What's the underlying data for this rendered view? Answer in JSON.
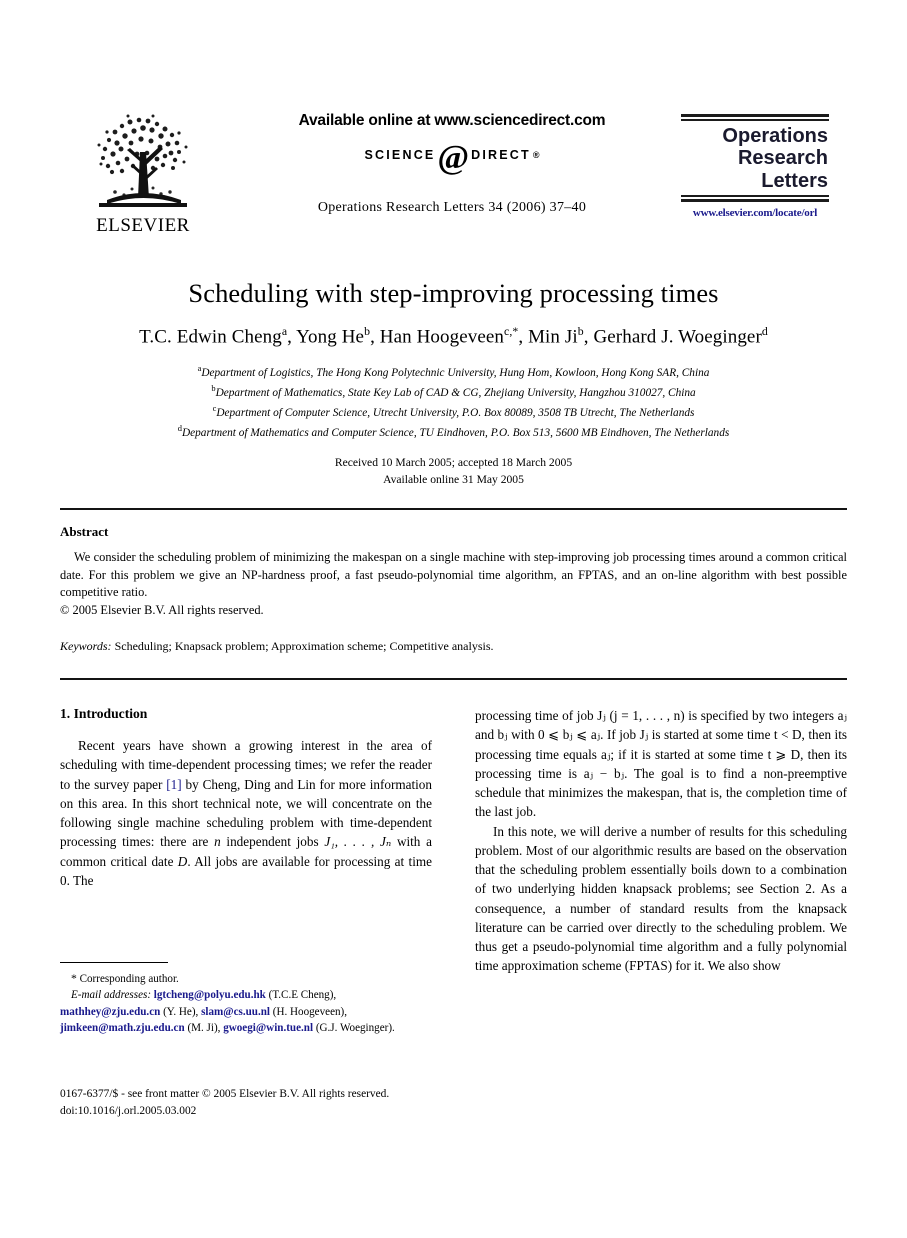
{
  "header": {
    "elsevier_wordmark": "ELSEVIER",
    "available_online": "Available online at www.sciencedirect.com",
    "sd_science": "SCIENCE",
    "sd_at": "@",
    "sd_direct": "DIRECT",
    "sd_registered": "®",
    "journal_reference": "Operations Research Letters 34 (2006) 37–40",
    "journal_name_line1": "Operations",
    "journal_name_line2": "Research",
    "journal_name_line3": "Letters",
    "journal_url": "www.elsevier.com/locate/orl"
  },
  "title": "Scheduling with step-improving processing times",
  "authors": {
    "full_line": "T.C. Edwin Cheng, Yong He, Han Hoogeveen, Min Ji, Gerhard J. Woeginger",
    "list": [
      {
        "name": "T.C. Edwin Cheng",
        "sup": "a"
      },
      {
        "name": "Yong He",
        "sup": "b"
      },
      {
        "name": "Han Hoogeveen",
        "sup": "c,*"
      },
      {
        "name": "Min Ji",
        "sup": "b"
      },
      {
        "name": "Gerhard J. Woeginger",
        "sup": "d"
      }
    ]
  },
  "affiliations": [
    {
      "marker": "a",
      "text": "Department of Logistics, The Hong Kong Polytechnic University, Hung Hom, Kowloon, Hong Kong SAR, China"
    },
    {
      "marker": "b",
      "text": "Department of Mathematics, State Key Lab of CAD & CG, Zhejiang University, Hangzhou 310027, China"
    },
    {
      "marker": "c",
      "text": "Department of Computer Science, Utrecht University, P.O. Box 80089, 3508 TB Utrecht, The Netherlands"
    },
    {
      "marker": "d",
      "text": "Department of Mathematics and Computer Science, TU Eindhoven, P.O. Box 513, 5600 MB Eindhoven, The Netherlands"
    }
  ],
  "dates": {
    "received": "Received 10 March 2005; accepted 18 March 2005",
    "available": "Available online 31 May 2005"
  },
  "abstract": {
    "heading": "Abstract",
    "body": "We consider the scheduling problem of minimizing the makespan on a single machine with step-improving job processing times around a common critical date. For this problem we give an NP-hardness proof, a fast pseudo-polynomial time algorithm, an FPTAS, and an on-line algorithm with best possible competitive ratio.",
    "copyright": "© 2005 Elsevier B.V. All rights reserved."
  },
  "keywords": {
    "label": "Keywords:",
    "value": "Scheduling; Knapsack problem; Approximation scheme; Competitive analysis."
  },
  "sections": {
    "introduction_heading": "1. Introduction"
  },
  "body": {
    "left_par1_a": "Recent years have shown a growing interest in the area of scheduling with time-dependent processing times; we refer the reader to the survey paper ",
    "left_par1_ref": "[1]",
    "left_par1_b": " by Cheng, Ding and Lin for more information on this area. In this short technical note, we will concentrate on the following single machine scheduling problem with time-dependent processing times: there are ",
    "left_par1_n": "n",
    "left_par1_c": " independent jobs ",
    "left_par1_jobs": "J₁, . . . , Jₙ",
    "left_par1_d": " with a common critical date ",
    "left_par1_D": "D",
    "left_par1_e": ". All jobs are available for processing at time 0. The",
    "right_par1": "processing time of job Jⱼ (j = 1, . . . , n) is specified by two integers aⱼ and bⱼ with 0 ⩽ bⱼ ⩽ aⱼ. If job Jⱼ is started at some time t < D, then its processing time equals aⱼ; if it is started at some time t ⩾ D, then its processing time is aⱼ − bⱼ. The goal is to find a non-preemptive schedule that minimizes the makespan, that is, the completion time of the last job.",
    "right_par2": "In this note, we will derive a number of results for this scheduling problem. Most of our algorithmic results are based on the observation that the scheduling problem essentially boils down to a combination of two underlying hidden knapsack problems; see Section 2. As a consequence, a number of standard results from the knapsack literature can be carried over directly to the scheduling problem. We thus get a pseudo-polynomial time algorithm and a fully polynomial time approximation scheme (FPTAS) for it. We also show"
  },
  "footnote": {
    "star": "*",
    "corresponding": "Corresponding author.",
    "email_label": "E-mail addresses:",
    "emails": [
      {
        "address": "lgtcheng@polyu.edu.hk",
        "owner": "(T.C.E Cheng),"
      },
      {
        "address": "mathhey@zju.edu.cn",
        "owner": "(Y. He),"
      },
      {
        "address": "slam@cs.uu.nl",
        "owner": "(H. Hoogeveen),"
      },
      {
        "address": "jimkeen@math.zju.edu.cn",
        "owner": "(M. Ji),"
      },
      {
        "address": "gwoegi@win.tue.nl",
        "owner": "(G.J. Woeginger)."
      }
    ]
  },
  "footer": {
    "issn_line": "0167-6377/$ - see front matter © 2005 Elsevier B.V. All rights reserved.",
    "doi_line": "doi:10.1016/j.orl.2005.03.002"
  },
  "colors": {
    "link_blue": "#1a1a8c",
    "rule_black": "#141414",
    "masthead_dark": "#1a1a2e"
  }
}
